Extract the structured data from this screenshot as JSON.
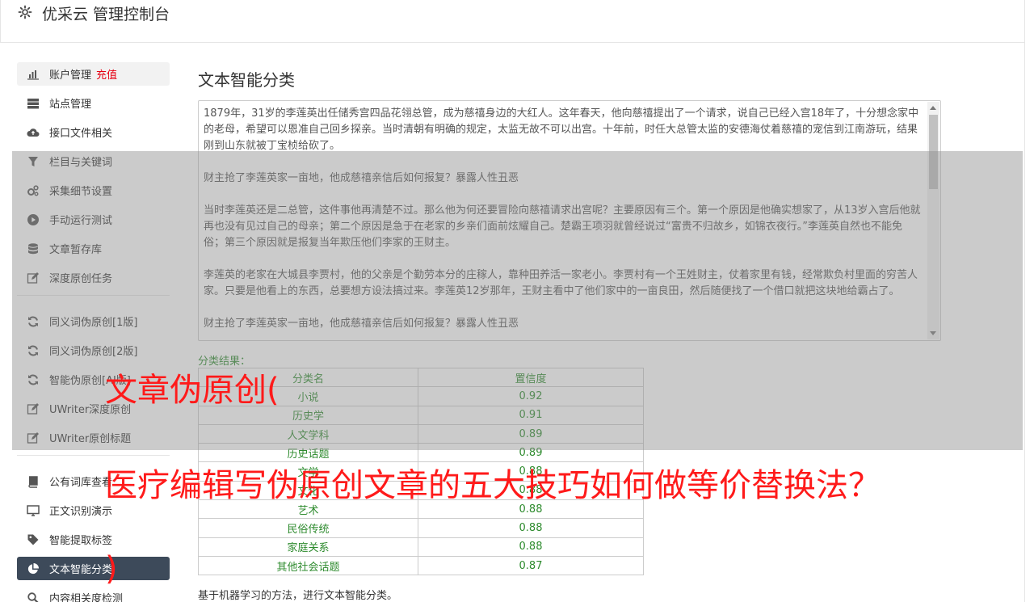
{
  "header": {
    "title": "优采云 管理控制台"
  },
  "sidebar": {
    "items": [
      {
        "label": "账户管理",
        "badge": "充值",
        "icon": "bar-chart-icon"
      },
      {
        "label": "站点管理",
        "icon": "server-icon"
      },
      {
        "label": "接口文件相关",
        "icon": "cloud-upload-icon"
      },
      {
        "label": "栏目与关键词",
        "icon": "filter-icon"
      },
      {
        "label": "采集细节设置",
        "icon": "gears-icon"
      },
      {
        "label": "手动运行测试",
        "icon": "play-circle-icon"
      },
      {
        "label": "文章暂存库",
        "icon": "database-icon"
      },
      {
        "label": "深度原创任务",
        "icon": "edit-icon"
      },
      {
        "label": "同义词伪原创[1版]",
        "icon": "refresh-icon"
      },
      {
        "label": "同义词伪原创[2版]",
        "icon": "refresh-icon"
      },
      {
        "label": "智能伪原创[AI版]",
        "icon": "refresh-icon"
      },
      {
        "label": "UWriter深度原创",
        "icon": "edit-icon"
      },
      {
        "label": "UWriter原创标题",
        "icon": "edit-icon"
      },
      {
        "label": "公有词库查看",
        "icon": "book-icon"
      },
      {
        "label": "正文识别演示",
        "icon": "monitor-icon"
      },
      {
        "label": "智能提取标签",
        "icon": "tag-icon"
      },
      {
        "label": "文本智能分类",
        "icon": "pie-chart-icon"
      },
      {
        "label": "内容相关度检测",
        "icon": "search-icon"
      }
    ]
  },
  "main": {
    "title": "文本智能分类",
    "text_paragraphs": [
      "1879年，31岁的李莲英出任储秀宫四品花翎总管，成为慈禧身边的大红人。这年春天，他向慈禧提出了一个请求，说自己已经入宫18年了，十分想念家中的老母，希望可以恩准自己回乡探亲。当时清朝有明确的规定，太监无故不可以出宫。十年前，时任大总管太监的安德海仗着慈禧的宠信到江南游玩，结果刚到山东就被丁宝桢给砍了。",
      "财主抢了李莲英家一亩地，他成慈禧亲信后如何报复？暴露人性丑恶",
      "当时李莲英还是二总管，这件事他再清楚不过。那么他为何还要冒险向慈禧请求出宫呢？主要原因有三个。第一个原因是他确实想家了，从13岁入宫后他就再也没有见过自己的母亲；第二个原因是急于在老家的乡亲们面前炫耀自己。楚霸王项羽就曾经说过“富贵不归故乡，如锦衣夜行。”李莲英自然也不能免俗；第三个原因就是报复当年欺压他们李家的王财主。",
      "李莲英的老家在大城县李贾村，他的父亲是个勤劳本分的庄稼人，靠种田养活一家老小。李贾村有一个王姓财主，仗着家里有钱，经常欺负村里面的穷苦人家。只要是他看上的东西，总要想方设法搞过来。李莲英12岁那年，王财主看中了他们家中的一亩良田，然后随便找了一个借口就把这块地给霸占了。",
      "财主抢了李莲英家一亩地，他成慈禧亲信后如何报复？暴露人性丑恶"
    ],
    "result_label": "分类结果：",
    "table": {
      "headers": [
        "分类名",
        "置信度"
      ],
      "rows": [
        [
          "小说",
          "0.92"
        ],
        [
          "历史学",
          "0.91"
        ],
        [
          "人文学科",
          "0.89"
        ],
        [
          "历史话题",
          "0.89"
        ],
        [
          "文学",
          "0.88"
        ],
        [
          "文化",
          "0.88"
        ],
        [
          "艺术",
          "0.88"
        ],
        [
          "民俗传统",
          "0.88"
        ],
        [
          "家庭关系",
          "0.88"
        ],
        [
          "其他社会话题",
          "0.87"
        ]
      ]
    },
    "description": "基于机器学习的方法，进行文本智能分类。"
  },
  "overlay": {
    "line1": "文章伪原创(",
    "line2": "医疗编辑写伪原创文章的五大技巧如何做等价替换法？",
    "line3": ")"
  },
  "colors": {
    "accent_red": "#e60012",
    "active_nav": "#3d4a5a",
    "result_green": "#2e8b2e",
    "overlay_red": "#ff1a1a"
  }
}
